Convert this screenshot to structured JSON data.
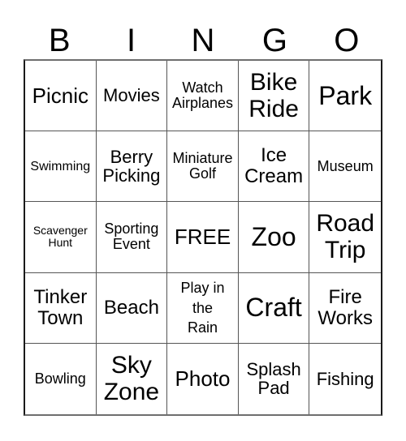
{
  "header": {
    "letters": [
      "B",
      "I",
      "N",
      "G",
      "O"
    ]
  },
  "board": {
    "cells": [
      [
        "Picnic",
        "Movies",
        "Watch\nAirplanes",
        "Bike\nRide",
        "Park"
      ],
      [
        "Swimming",
        "Berry\nPicking",
        "Miniature\nGolf",
        "Ice\nCream",
        "Museum"
      ],
      [
        "Scavenger\nHunt",
        "Sporting\nEvent",
        "FREE",
        "Zoo",
        "Road\nTrip"
      ],
      [
        "Tinker\nTown",
        "Beach",
        "Play in\nthe\nRain",
        "Craft",
        "Fire\nWorks"
      ],
      [
        "Bowling",
        "Sky\nZone",
        "Photo",
        "Splash\nPad",
        "Fishing"
      ]
    ]
  }
}
